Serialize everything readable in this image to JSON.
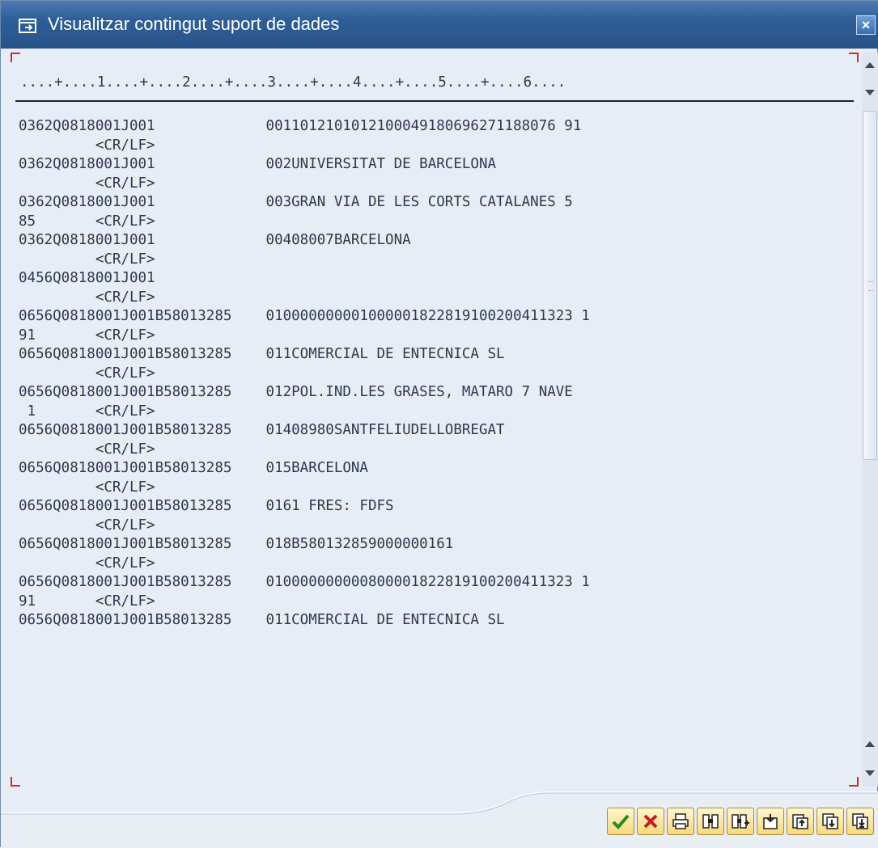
{
  "window": {
    "title": "Visualitzar contingut suport de dades"
  },
  "ruler": "....+....1....+....2....+....3....+....4....+....5....+....6....",
  "lines": [
    "0362Q0818001J001             0011012101012100049180696271188076 91",
    "         <CR/LF>",
    "0362Q0818001J001             002UNIVERSITAT DE BARCELONA",
    "         <CR/LF>",
    "0362Q0818001J001             003GRAN VIA DE LES CORTS CATALANES 5",
    "85       <CR/LF>",
    "0362Q0818001J001             00408007BARCELONA",
    "         <CR/LF>",
    "0456Q0818001J001",
    "         <CR/LF>",
    "0656Q0818001J001B58013285    010000000001000001822819100200411323 1",
    "91       <CR/LF>",
    "0656Q0818001J001B58013285    011COMERCIAL DE ENTECNICA SL",
    "         <CR/LF>",
    "0656Q0818001J001B58013285    012POL.IND.LES GRASES, MATARO 7 NAVE",
    " 1       <CR/LF>",
    "0656Q0818001J001B58013285    01408980SANTFELIUDELLOBREGAT",
    "         <CR/LF>",
    "0656Q0818001J001B58013285    015BARCELONA",
    "         <CR/LF>",
    "0656Q0818001J001B58013285    0161 FRES: FDFS",
    "         <CR/LF>",
    "0656Q0818001J001B58013285    018B580132859000000161",
    "         <CR/LF>",
    "0656Q0818001J001B58013285    010000000000800001822819100200411323 1",
    "91       <CR/LF>",
    "0656Q0818001J001B58013285    011COMERCIAL DE ENTECNICA SL"
  ],
  "toolbar": [
    "continue-icon",
    "cancel-icon",
    "print-icon",
    "find-icon",
    "find-next-icon",
    "first-page-icon",
    "previous-page-icon",
    "next-page-icon",
    "last-page-icon"
  ]
}
